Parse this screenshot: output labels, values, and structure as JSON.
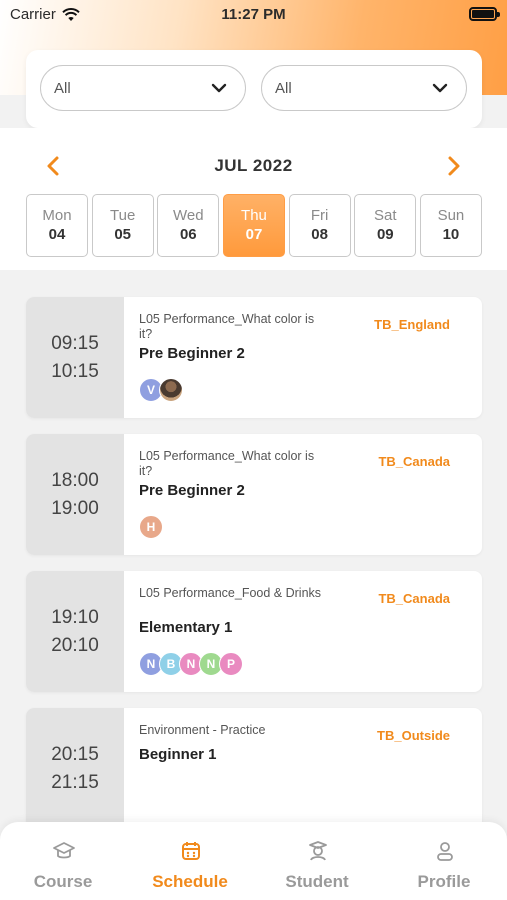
{
  "status_bar": {
    "carrier": "Carrier",
    "time": "11:27 PM"
  },
  "filters": [
    {
      "value": "All"
    },
    {
      "value": "All"
    }
  ],
  "calendar": {
    "month_label": "JUL 2022",
    "days": [
      {
        "name": "Mon",
        "num": "04",
        "active": false
      },
      {
        "name": "Tue",
        "num": "05",
        "active": false
      },
      {
        "name": "Wed",
        "num": "06",
        "active": false
      },
      {
        "name": "Thu",
        "num": "07",
        "active": true
      },
      {
        "name": "Fri",
        "num": "08",
        "active": false
      },
      {
        "name": "Sat",
        "num": "09",
        "active": false
      },
      {
        "name": "Sun",
        "num": "10",
        "active": false
      }
    ]
  },
  "lessons": [
    {
      "start": "09:15",
      "end": "10:15",
      "subtitle": "L05 Performance_What color is it?",
      "title": "Pre Beginner 2",
      "room": "TB_England",
      "avatars": [
        {
          "letter": "V",
          "color": "#8f9fe0"
        },
        {
          "letter": "",
          "photo": true
        }
      ]
    },
    {
      "start": "18:00",
      "end": "19:00",
      "subtitle": "L05 Performance_What color is it?",
      "title": "Pre Beginner 2",
      "room": "TB_Canada",
      "avatars": [
        {
          "letter": "H",
          "color": "#e8a88a"
        }
      ]
    },
    {
      "start": "19:10",
      "end": "20:10",
      "subtitle": "L05 Performance_Food & Drinks",
      "title": "Elementary 1",
      "room": "TB_Canada",
      "avatars": [
        {
          "letter": "N",
          "color": "#8f9fe0"
        },
        {
          "letter": "B",
          "color": "#8fd0e8"
        },
        {
          "letter": "N",
          "color": "#e98ac0"
        },
        {
          "letter": "N",
          "color": "#9fd98f"
        },
        {
          "letter": "P",
          "color": "#e98ac0"
        }
      ]
    },
    {
      "start": "20:15",
      "end": "21:15",
      "subtitle": "Environment - Practice",
      "title": "Beginner 1",
      "room": "TB_Outside",
      "avatars": []
    }
  ],
  "tabbar": {
    "tabs": [
      {
        "label": "Course",
        "icon": "graduation-cap-icon"
      },
      {
        "label": "Schedule",
        "icon": "calendar-icon",
        "active": true
      },
      {
        "label": "Student",
        "icon": "student-icon"
      },
      {
        "label": "Profile",
        "icon": "person-icon"
      }
    ]
  },
  "colors": {
    "accent": "#f18a1c",
    "active_day": "#ff9d45"
  }
}
